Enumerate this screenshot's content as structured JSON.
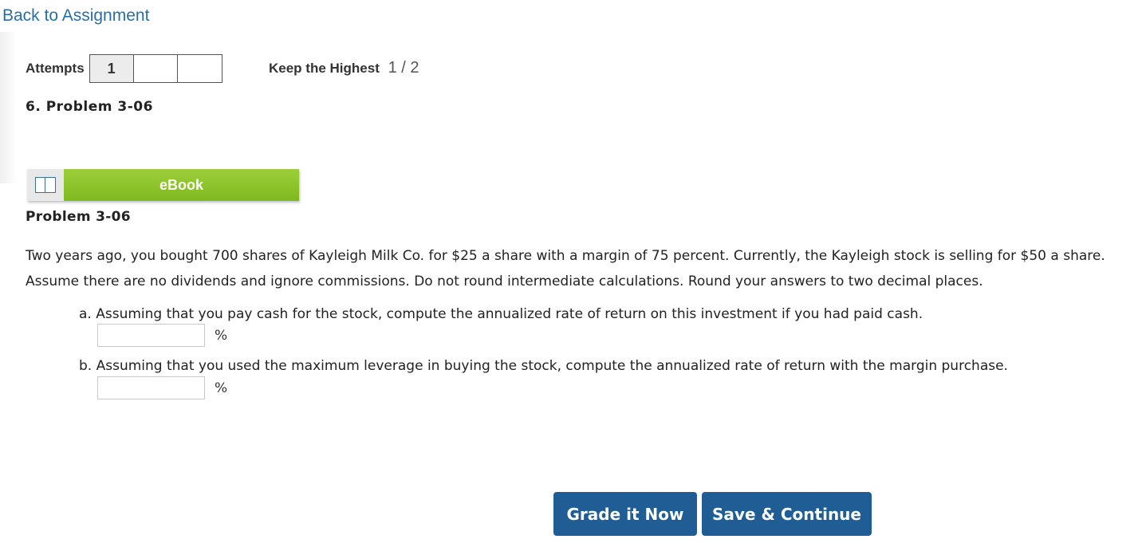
{
  "nav": {
    "back_label": "Back to Assignment"
  },
  "attempts": {
    "label": "Attempts",
    "boxes": [
      "1",
      "",
      ""
    ]
  },
  "keep_highest": {
    "label": "Keep the Highest",
    "score": "1 / 2"
  },
  "problem": {
    "heading": "6.  Problem 3-06",
    "ebook_label": "eBook",
    "title": "Problem 3-06",
    "text": "Two years ago, you bought 700 shares of Kayleigh Milk Co. for $25 a share with a margin of 75 percent. Currently, the Kayleigh stock is selling for $50 a share. Assume there are no dividends and ignore commissions. Do not round intermediate calculations. Round your answers to two decimal places.",
    "questions": [
      {
        "text": "a. Assuming that you pay cash for the stock, compute the annualized rate of return on this investment if you had paid cash.",
        "value": "",
        "unit": "%"
      },
      {
        "text": "b. Assuming that you used the maximum leverage in buying the stock, compute the annualized rate of return with the margin purchase.",
        "value": "",
        "unit": "%"
      }
    ]
  },
  "actions": {
    "grade_label": "Grade it Now",
    "save_label": "Save & Continue"
  },
  "colors": {
    "link": "#2a6ea3",
    "ebook_green": "#8cc42a",
    "primary_button": "#1f5d94"
  }
}
